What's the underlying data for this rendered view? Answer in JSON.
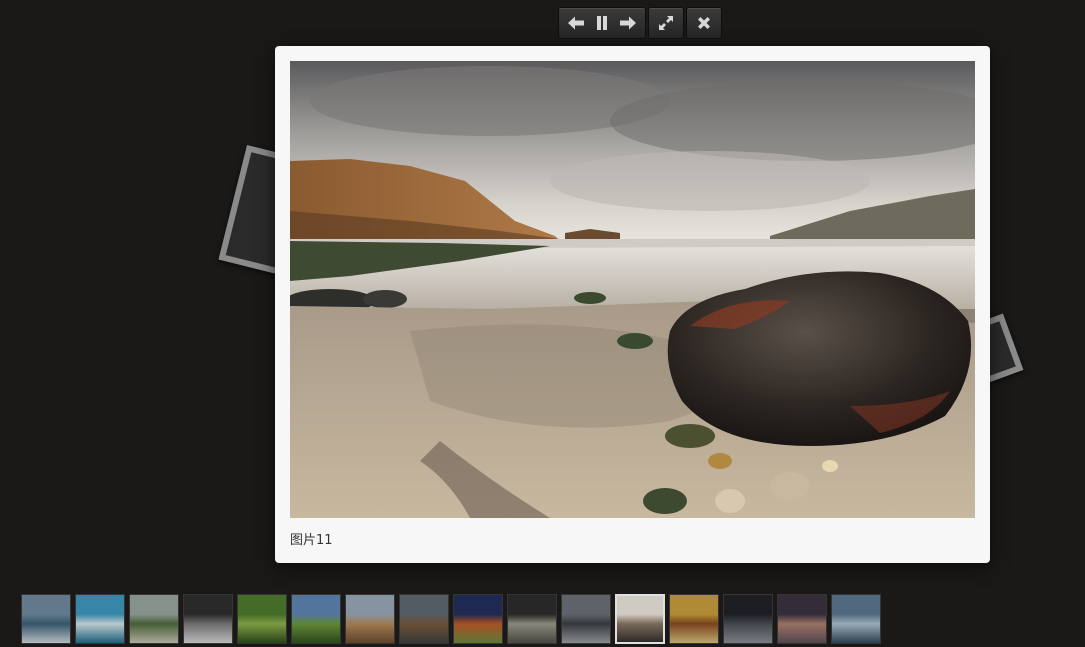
{
  "toolbar": {
    "buttons": [
      {
        "name": "prev-button",
        "icon": "arrow-left-icon"
      },
      {
        "name": "pause-button",
        "icon": "pause-icon"
      },
      {
        "name": "next-button",
        "icon": "arrow-right-icon"
      },
      {
        "name": "fullscreen-button",
        "icon": "expand-icon"
      },
      {
        "name": "close-button",
        "icon": "close-icon"
      }
    ],
    "icon_color": "#d8d8d8"
  },
  "lightbox": {
    "caption": "图片11",
    "image_icon": "beach-rock-photo"
  },
  "thumbnails": {
    "count": 16,
    "active_index": 11,
    "items": [
      {
        "subject": "surfer",
        "colors": [
          "#6f8aa0",
          "#3a5f7a",
          "#cfd8dc"
        ]
      },
      {
        "subject": "swimmer",
        "colors": [
          "#3b9bc0",
          "#d8e8ee",
          "#1c6c8c"
        ]
      },
      {
        "subject": "coast-hills",
        "colors": [
          "#9aa7a0",
          "#4f6b3d",
          "#c9c4b3"
        ]
      },
      {
        "subject": "pier-under",
        "colors": [
          "#2c2c2c",
          "#7b7b7b",
          "#d6d6d6"
        ]
      },
      {
        "subject": "bamboo",
        "colors": [
          "#4c7a2a",
          "#8fb24a",
          "#2a4a18"
        ]
      },
      {
        "subject": "green-field",
        "colors": [
          "#5e86b5",
          "#6a9a3a",
          "#2e4f1c"
        ]
      },
      {
        "subject": "colosseum",
        "colors": [
          "#9aa9b8",
          "#b68a5a",
          "#6a4a2e"
        ]
      },
      {
        "subject": "driftwood",
        "colors": [
          "#5e6870",
          "#7a5a3a",
          "#3a3e40"
        ]
      },
      {
        "subject": "sunset-field",
        "colors": [
          "#1e2c5a",
          "#c05a28",
          "#6a8a3a"
        ]
      },
      {
        "subject": "iron-bridge",
        "colors": [
          "#2a2a2a",
          "#9a9a8a",
          "#505048"
        ]
      },
      {
        "subject": "misty-shore",
        "colors": [
          "#6a7078",
          "#3a3e44",
          "#9aa0a6"
        ]
      },
      {
        "subject": "beach-rock",
        "colors": [
          "#cfcac2",
          "#7a6a58",
          "#2e2a28"
        ]
      },
      {
        "subject": "spices",
        "colors": [
          "#c8a03a",
          "#8a4a1e",
          "#d8c27a"
        ]
      },
      {
        "subject": "car-night",
        "colors": [
          "#1e2024",
          "#4a4e56",
          "#8a8e96"
        ]
      },
      {
        "subject": "dusk-harbor",
        "colors": [
          "#3a3040",
          "#b08070",
          "#5a4e56"
        ]
      },
      {
        "subject": "surfer-wave",
        "colors": [
          "#5a7890",
          "#aec4d0",
          "#2e4658"
        ]
      }
    ]
  }
}
